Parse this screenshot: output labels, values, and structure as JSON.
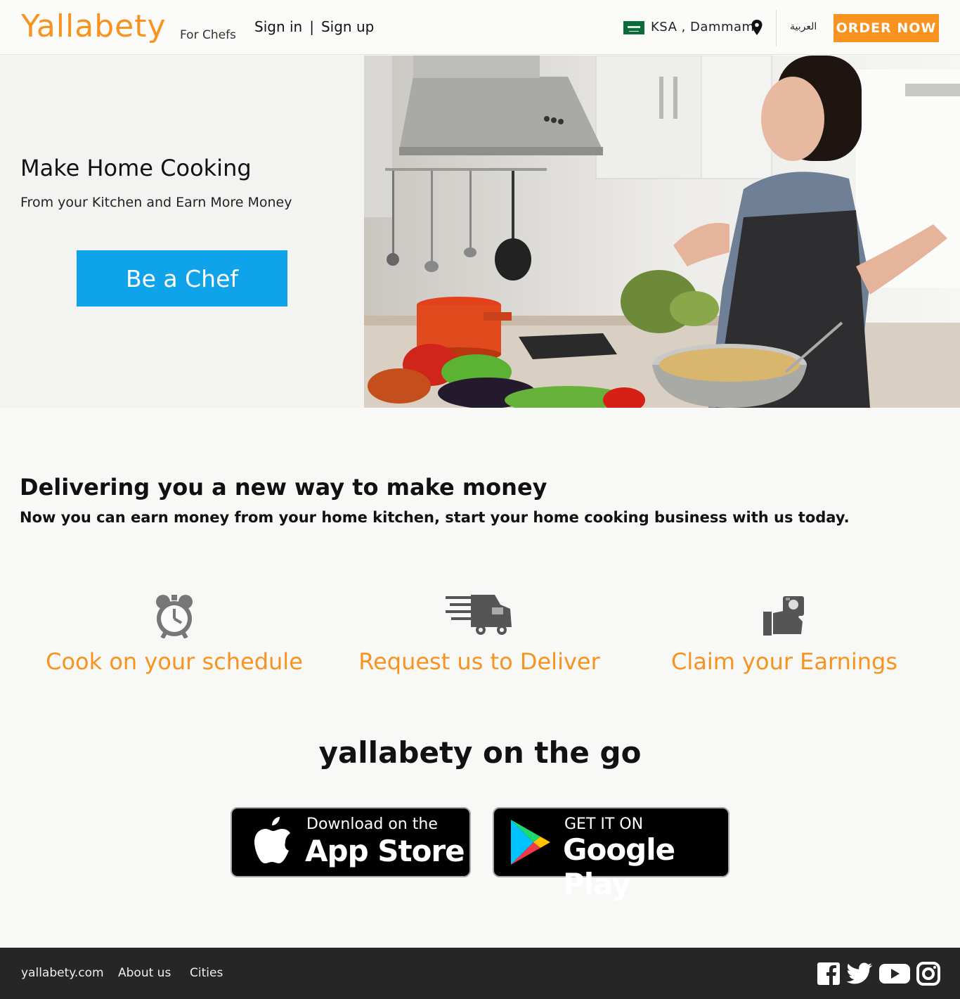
{
  "header": {
    "logo": "Yallabety",
    "logo_sub": "For Chefs",
    "sign_in": "Sign in",
    "separator": "|",
    "sign_up": "Sign up",
    "location": "KSA , Dammam",
    "language": "العربية",
    "order_now": "ORDER NOW"
  },
  "hero": {
    "title": "Make Home Cooking",
    "subtitle": "From your Kitchen and Earn More Money",
    "cta": "Be a Chef"
  },
  "intro": {
    "title": "Delivering you a new way to make money",
    "subtitle": "Now you can earn money  from your home kitchen, start your home cooking business with us today."
  },
  "features": [
    {
      "icon": "alarm-clock-icon",
      "label": "Cook on your schedule"
    },
    {
      "icon": "delivery-truck-icon",
      "label": "Request us to Deliver"
    },
    {
      "icon": "money-hand-icon",
      "label": "Claim your Earnings"
    }
  ],
  "apps": {
    "title": "yallabety on the go",
    "appstore_small": "Download on the",
    "appstore_big": "App Store",
    "play_small": "GET IT ON",
    "play_big": "Google Play"
  },
  "footer": {
    "links": [
      "yallabety.com",
      "About us",
      "Cities"
    ],
    "social": [
      "facebook-icon",
      "twitter-icon",
      "youtube-icon",
      "instagram-icon"
    ]
  },
  "colors": {
    "accent": "#f7931e",
    "cta_blue": "#0fa3e9",
    "footer_bg": "#262626"
  }
}
